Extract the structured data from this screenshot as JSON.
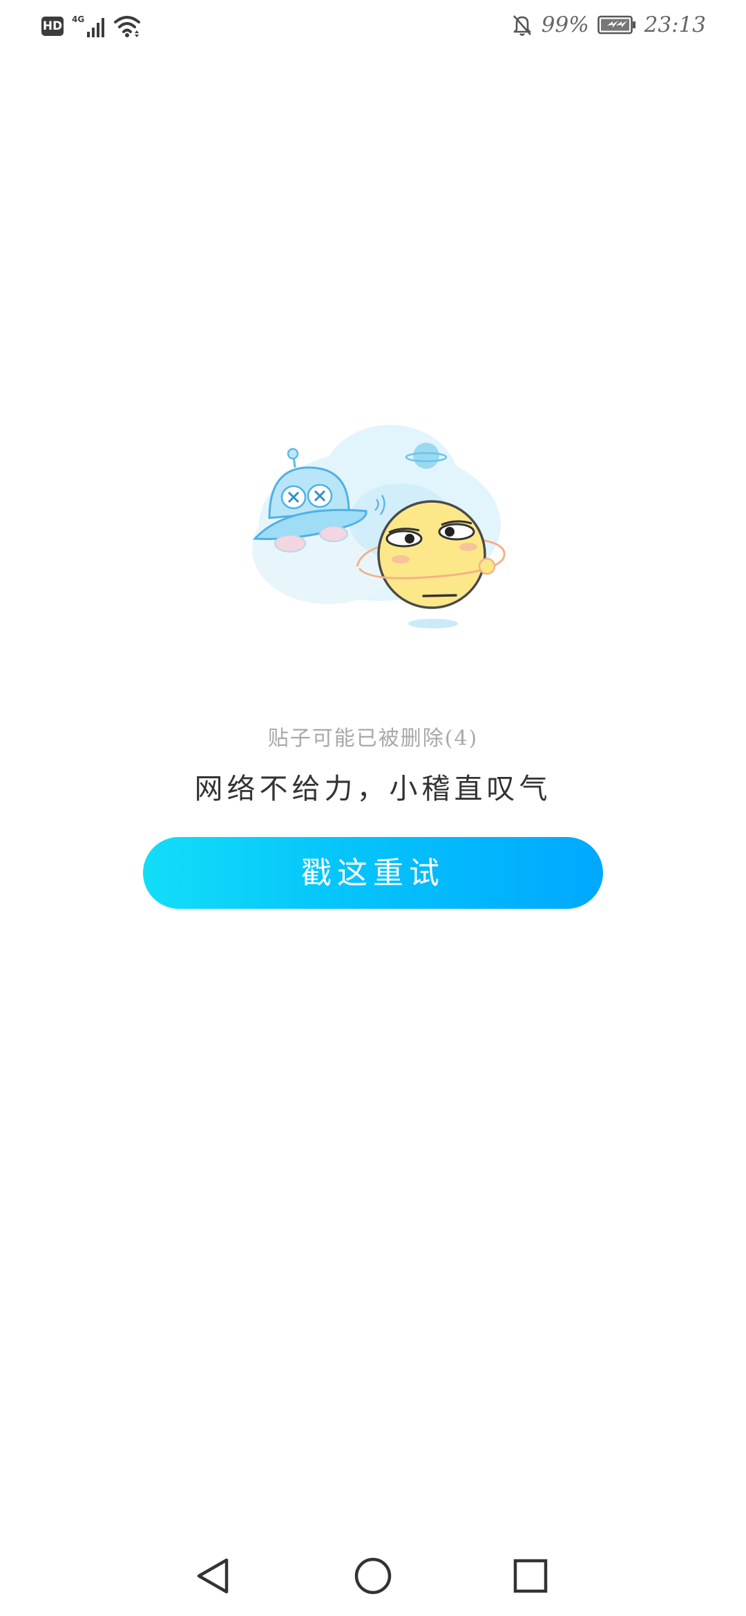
{
  "status_bar": {
    "hd_label": "HD",
    "network_label": "4G",
    "battery_percent": "99%",
    "time": "23:13",
    "icons": [
      "hd-icon",
      "signal-icon",
      "wifi-icon",
      "bell-off-icon",
      "battery-charging-icon"
    ]
  },
  "error": {
    "sub_message": "贴子可能已被删除(4)",
    "main_message": "网络不给力，小稽直叹气"
  },
  "retry_button": {
    "label": "戳这重试"
  },
  "navigation": {
    "icons": [
      "back-icon",
      "home-icon",
      "recent-apps-icon"
    ]
  },
  "colors": {
    "accent_start": "#12def8",
    "accent_end": "#00a8ff",
    "sub_text": "#a8a8a8",
    "main_text": "#333333",
    "status_text": "#666666"
  }
}
